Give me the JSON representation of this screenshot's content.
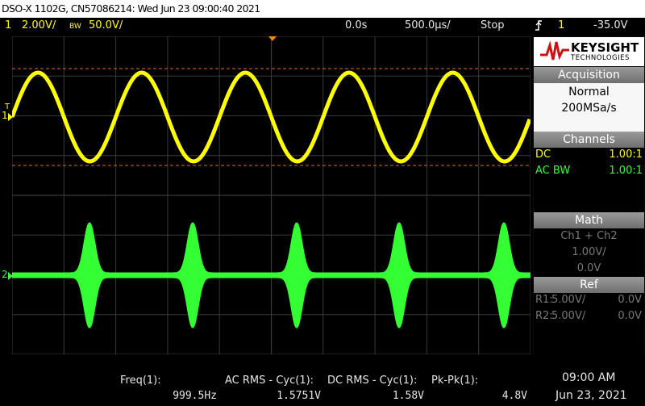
{
  "title": "DSO-X 1102G, CN57086214: Wed Jun 23 09:00:40 2021",
  "status": {
    "ch1_number": "1",
    "ch1_scale": "2.00V/",
    "bw_badge": "BW",
    "bw_value": "50.0V/",
    "time_offset": "0.0s",
    "time_scale": "500.0µs/",
    "run_state": "Stop",
    "trigger_icon": "trigger-edge-icon",
    "trigger_source": "1",
    "trigger_level": "-35.0V"
  },
  "brand": {
    "name": "KEYSIGHT",
    "sub": "TECHNOLOGIES"
  },
  "panels": {
    "acquisition": {
      "title": "Acquisition",
      "mode": "Normal",
      "rate": "200MSa/s"
    },
    "channels": {
      "title": "Channels",
      "rows": [
        {
          "label": "DC",
          "value": "1.00:1",
          "color": "#ffff00"
        },
        {
          "label": "AC BW",
          "value": "1.00:1",
          "color": "#33ff33"
        }
      ]
    },
    "math": {
      "title": "Math",
      "function": "Ch1 + Ch2",
      "scale": "1.00V/",
      "offset": "0.0V"
    },
    "ref": {
      "title": "Ref",
      "rows": [
        {
          "label": "R1:",
          "scale": "5.00V/",
          "offset": "0.0V"
        },
        {
          "label": "R2:",
          "scale": "5.00V/",
          "offset": "0.0V"
        }
      ]
    }
  },
  "markers": {
    "ch1": "1",
    "ch2": "2",
    "trigger": "T"
  },
  "measurements": [
    {
      "label": "Freq(1):",
      "value": "999.5Hz"
    },
    {
      "label": "AC RMS - Cyc(1):",
      "value": "1.5751V"
    },
    {
      "label": "DC RMS - Cyc(1):",
      "value": "1.58V"
    },
    {
      "label": "Pk-Pk(1):",
      "value": "4.8V"
    }
  ],
  "clock": {
    "time": "09:00 AM",
    "date": "Jun 23, 2021"
  },
  "colors": {
    "ch1": "#ffff00",
    "ch2": "#33ff33",
    "grid": "#3a3a3a",
    "cursor": "#e06a2a",
    "accent": "#e88a1a"
  }
}
